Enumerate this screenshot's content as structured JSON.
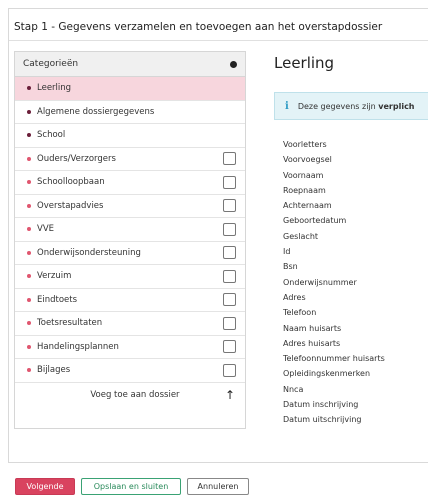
{
  "dialog": {
    "title": "Stap 1 - Gegevens verzamelen en toevoegen aan het overstapdossier"
  },
  "categories": {
    "header": "Categorieën",
    "items": [
      {
        "label": "Leerling",
        "bullet_color": "#6b1f3a",
        "active": true,
        "checkbox": false
      },
      {
        "label": "Algemene dossiergegevens",
        "bullet_color": "#6b1f3a",
        "active": false,
        "checkbox": false
      },
      {
        "label": "School",
        "bullet_color": "#6b1f3a",
        "active": false,
        "checkbox": false
      },
      {
        "label": "Ouders/Verzorgers",
        "bullet_color": "#e0566f",
        "active": false,
        "checkbox": true
      },
      {
        "label": "Schoolloopbaan",
        "bullet_color": "#e0566f",
        "active": false,
        "checkbox": true
      },
      {
        "label": "Overstapadvies",
        "bullet_color": "#e0566f",
        "active": false,
        "checkbox": true
      },
      {
        "label": "VVE",
        "bullet_color": "#e0566f",
        "active": false,
        "checkbox": true
      },
      {
        "label": "Onderwijsondersteuning",
        "bullet_color": "#e0566f",
        "active": false,
        "checkbox": true
      },
      {
        "label": "Verzuim",
        "bullet_color": "#e0566f",
        "active": false,
        "checkbox": true
      },
      {
        "label": "Eindtoets",
        "bullet_color": "#e0566f",
        "active": false,
        "checkbox": true
      },
      {
        "label": "Toetsresultaten",
        "bullet_color": "#e0566f",
        "active": false,
        "checkbox": true
      },
      {
        "label": "Handelingsplannen",
        "bullet_color": "#e0566f",
        "active": false,
        "checkbox": true
      },
      {
        "label": "Bijlages",
        "bullet_color": "#e0566f",
        "active": false,
        "checkbox": true
      }
    ],
    "add_label": "Voeg toe aan dossier",
    "add_icon": "arrow-up-icon"
  },
  "detail": {
    "title": "Leerling",
    "notice_icon": "info-icon",
    "notice_prefix": "Deze gegevens zijn ",
    "notice_bold": "verplich",
    "fields": [
      "Voorletters",
      "Voorvoegsel",
      "Voornaam",
      "Roepnaam",
      "Achternaam",
      "Geboortedatum",
      "Geslacht",
      "Id",
      "Bsn",
      "Onderwijsnummer",
      "Adres",
      "Telefoon",
      "Naam huisarts",
      "Adres huisarts",
      "Telefoonnummer huisarts",
      "Opleidingskenmerken",
      "Nnca",
      "Datum inschrijving",
      "Datum uitschrijving"
    ]
  },
  "footer": {
    "next_label": "Volgende",
    "save_label": "Opslaan en sluiten",
    "cancel_label": "Annuleren"
  },
  "colors": {
    "accent": "#d9435f",
    "active_row": "#f7d6dd",
    "save_green": "#2a8a5b",
    "info_blue": "#2f9bc4"
  }
}
